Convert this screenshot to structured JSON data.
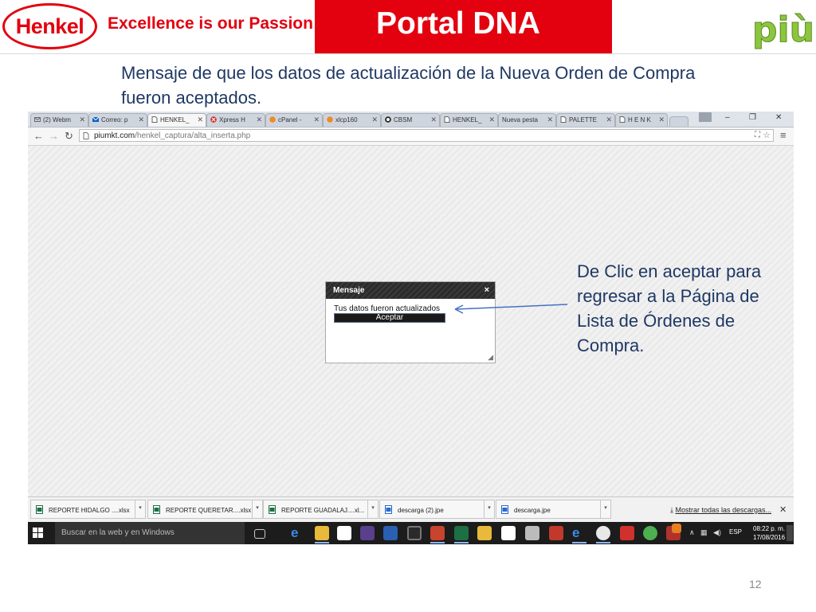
{
  "slide": {
    "logo_text": "Henkel",
    "tagline": "Excellence is our Passion",
    "banner_title": "Portal  DNA",
    "brand_logo_text": "più",
    "caption": "Mensaje de que los datos de actualización de la Nueva Orden de Compra fueron aceptados.",
    "callout": "De Clic en aceptar para regresar a la Página  de Lista de Órdenes de Compra.",
    "page_number": "12",
    "colors": {
      "henkel_red": "#e3000f",
      "caption_blue": "#1f3864",
      "piu_green": "#8cc63f"
    }
  },
  "browser": {
    "tabs": [
      {
        "label": "(2) Webm",
        "icon": "mail-icon"
      },
      {
        "label": "Correo: p",
        "icon": "outlook-icon"
      },
      {
        "label": "HENKEL_",
        "icon": "page-icon",
        "active": true
      },
      {
        "label": "Xpress H",
        "icon": "xpress-icon"
      },
      {
        "label": "cPanel -",
        "icon": "cpanel-icon"
      },
      {
        "label": "xlcp160",
        "icon": "cpanel-icon"
      },
      {
        "label": "CBSM",
        "icon": "cbsm-icon"
      },
      {
        "label": "HENKEL_",
        "icon": "page-icon"
      },
      {
        "label": "Nueva pesta",
        "icon": "none"
      },
      {
        "label": "PALETTE",
        "icon": "page-icon"
      },
      {
        "label": "H E N K",
        "icon": "page-icon"
      }
    ],
    "url_host": "piumkt.com",
    "url_path": "/henkel_captura/alta_inserta.php"
  },
  "dialog": {
    "title": "Mensaje",
    "message": "Tus datos fueron actualizados",
    "button": "Aceptar"
  },
  "downloads": {
    "items": [
      {
        "name": "REPORTE HIDALGO ....xlsx",
        "icon": "excel-icon"
      },
      {
        "name": "REPORTE QUERETAR....xlsx",
        "icon": "excel-icon"
      },
      {
        "name": "REPORTE GUADALAJ....xl...",
        "icon": "excel-icon"
      },
      {
        "name": "descarga (2).jpe",
        "icon": "image-file-icon"
      },
      {
        "name": "descarga.jpe",
        "icon": "image-file-icon"
      }
    ],
    "show_all": "Mostrar todas las descargas..."
  },
  "taskbar": {
    "search_placeholder": "Buscar en la web y en Windows",
    "language": "ESP",
    "time": "08:22 p. m.",
    "date": "17/08/2016"
  }
}
